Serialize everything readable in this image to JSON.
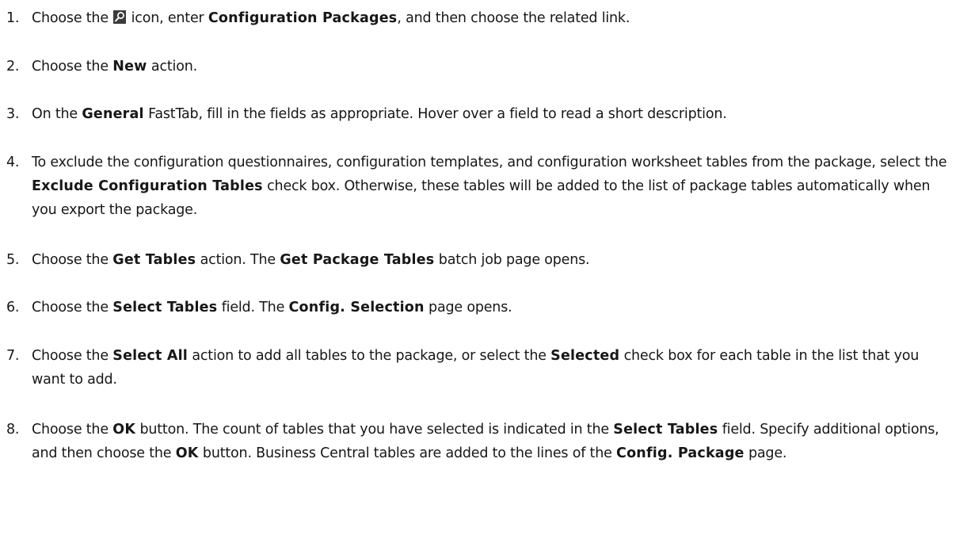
{
  "steps": [
    {
      "number": "1.",
      "parts": [
        {
          "t": "Choose the "
        },
        {
          "icon": "search-icon"
        },
        {
          "t": " icon, enter "
        },
        {
          "b": "Configuration Packages"
        },
        {
          "t": ", and then choose the related link."
        }
      ]
    },
    {
      "number": "2.",
      "parts": [
        {
          "t": "Choose the "
        },
        {
          "b": "New"
        },
        {
          "t": " action."
        }
      ]
    },
    {
      "number": "3.",
      "parts": [
        {
          "t": "On the "
        },
        {
          "b": "General"
        },
        {
          "t": " FastTab, fill in the fields as appropriate. Hover over a field to read a short description."
        }
      ]
    },
    {
      "number": "4.",
      "parts": [
        {
          "t": "To exclude the configuration questionnaires, configuration templates, and configuration worksheet tables from the package, select the "
        },
        {
          "b": "Exclude Configuration Tables"
        },
        {
          "t": " check box. Otherwise, these tables will be added to the list of package tables automatically when you export the package."
        }
      ]
    },
    {
      "number": "5.",
      "parts": [
        {
          "t": "Choose the "
        },
        {
          "b": "Get Tables"
        },
        {
          "t": " action. The "
        },
        {
          "b": "Get Package Tables"
        },
        {
          "t": " batch job page opens."
        }
      ]
    },
    {
      "number": "6.",
      "parts": [
        {
          "t": "Choose the "
        },
        {
          "b": "Select Tables"
        },
        {
          "t": " field. The "
        },
        {
          "b": "Config. Selection"
        },
        {
          "t": " page opens."
        }
      ]
    },
    {
      "number": "7.",
      "parts": [
        {
          "t": "Choose the "
        },
        {
          "b": "Select All"
        },
        {
          "t": " action to add all tables to the package, or select the "
        },
        {
          "b": "Selected"
        },
        {
          "t": " check box for each table in the list that you want to add."
        }
      ]
    },
    {
      "number": "8.",
      "parts": [
        {
          "t": "Choose the "
        },
        {
          "b": "OK"
        },
        {
          "t": " button. The count of tables that you have selected is indicated in the "
        },
        {
          "b": "Select Tables"
        },
        {
          "t": " field. Specify additional options, and then choose the "
        },
        {
          "b": "OK"
        },
        {
          "t": " button. Business Central tables are added to the lines of the "
        },
        {
          "b": "Config. Package"
        },
        {
          "t": " page."
        }
      ]
    }
  ]
}
